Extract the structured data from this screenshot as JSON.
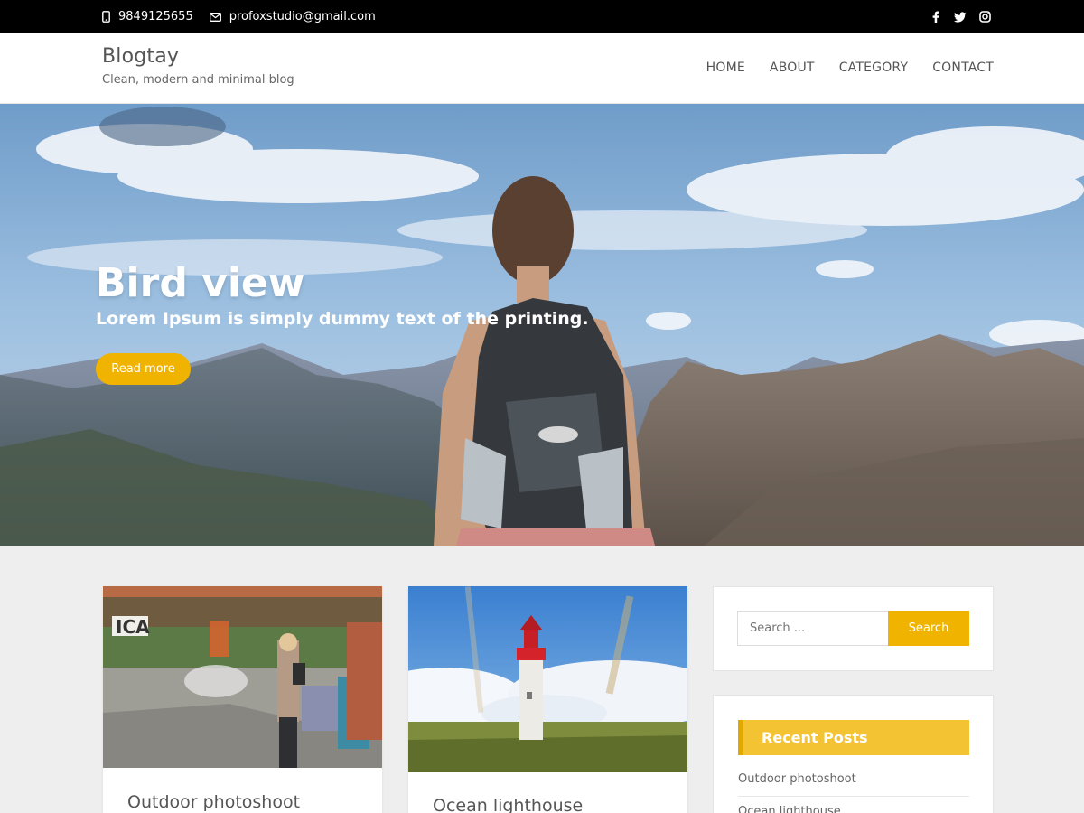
{
  "topbar": {
    "phone": "9849125655",
    "email": "profoxstudio@gmail.com",
    "social": [
      "facebook-icon",
      "twitter-icon",
      "instagram-icon"
    ]
  },
  "site": {
    "title": "Blogtay",
    "tagline": "Clean, modern and minimal blog"
  },
  "nav": {
    "items": [
      "HOME",
      "ABOUT",
      "CATEGORY",
      "CONTACT"
    ]
  },
  "hero": {
    "title": "Bird view",
    "subtitle": "Lorem Ipsum is simply dummy text of the printing.",
    "button": "Read more"
  },
  "posts": [
    {
      "title": "Outdoor photoshoot"
    },
    {
      "title": "Ocean lighthouse"
    }
  ],
  "sidebar": {
    "search_placeholder": "Search ...",
    "search_button": "Search",
    "recent_heading": "Recent Posts",
    "recent_items": [
      "Outdoor photoshoot",
      "Ocean lighthouse"
    ]
  },
  "colors": {
    "accent": "#f0b400",
    "recent_heading_bg": "#f3c334",
    "topbar_bg": "#000000"
  }
}
